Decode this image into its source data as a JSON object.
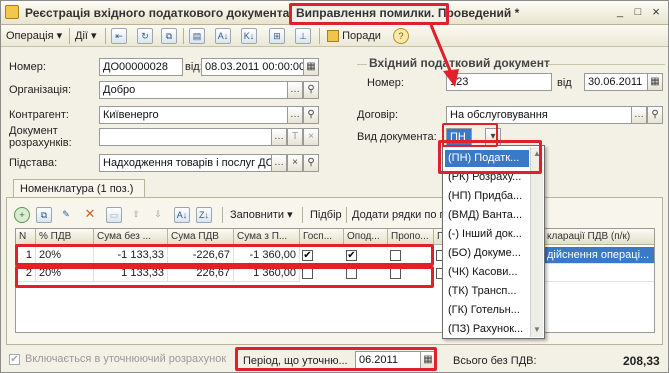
{
  "title": {
    "prefix": "Реєстрація вхідного податкового документа",
    "highlight": "Виправлення помилки. Проведений *"
  },
  "window_buttons": [
    "_",
    "□",
    "×"
  ],
  "toolbar": {
    "operation": "Операція",
    "actions": "Дії",
    "tips": "Поради",
    "icons": [
      "arrow-back-icon",
      "refresh-icon",
      "copy-icon",
      "post-icon",
      "sort-az-icon",
      "sort-ka-icon",
      "structure-icon",
      "pin-icon",
      "help-icon"
    ]
  },
  "form": {
    "number_label": "Номер:",
    "number_value": "ДО00000028",
    "from_label": "від:",
    "from_value": "08.03.2011 00:00:00",
    "org_label": "Організація:",
    "org_value": "Добро",
    "contractor_label": "Контрагент:",
    "contractor_value": "Київенерго",
    "settlement_doc_label_1": "Документ",
    "settlement_doc_label_2": "розрахунків:",
    "settlement_doc_value": "",
    "basis_label": "Підстава:",
    "basis_value": "Надходження товарів і послуг ДС"
  },
  "incoming_doc": {
    "group_title": "Вхідний податковий документ",
    "number_label": "Номер:",
    "number_value": "123",
    "from_label": "від",
    "from_value": "30.06.2011",
    "contract_label": "Договір:",
    "contract_value": "На обслуговування",
    "doc_type_label": "Вид документа:",
    "doc_type_value": "ПН"
  },
  "dropdown": {
    "items": [
      "(ПН) Податк...",
      "(РК) Розраху...",
      "(НП) Придба...",
      "(ВМД) Ванта...",
      "(-) Інший док...",
      "(БО) Докуме...",
      "(ЧК) Касови...",
      "(ТК) Трансп...",
      "(ГК) Готельн...",
      "(ПЗ) Рахунок..."
    ]
  },
  "tab": {
    "label": "Номенклатура (1 поз.)"
  },
  "grid_toolbar": {
    "fill": "Заповнити",
    "selection": "Підбір",
    "add_rows": "Додати рядки по п"
  },
  "grid": {
    "headers": [
      "N",
      "% ПДВ",
      "Сума без ...",
      "Сума ПДВ",
      "Сума з П...",
      "Госп...",
      "Опод...",
      "Пропо...",
      "П",
      "кларації ПДВ (п/к)"
    ],
    "rows": [
      {
        "n": "1",
        "vat": "20%",
        "without": "-1 133,33",
        "vat_sum": "-226,67",
        "with_vat": "-1 360,00",
        "c1": true,
        "c2": true,
        "c3": false,
        "c4": false,
        "decl": "дійснення операці..."
      },
      {
        "n": "2",
        "vat": "20%",
        "without": "1 133,33",
        "vat_sum": "226,67",
        "with_vat": "1 360,00",
        "c1": false,
        "c2": false,
        "c3": false,
        "c4": false,
        "decl": ""
      }
    ]
  },
  "bottom": {
    "include_label": "Включається в уточнюючий розрахунок",
    "period_label": "Період, що уточню...",
    "period_value": "06.2011",
    "total_label": "Всього без ПДВ:",
    "total_value": "208,33"
  },
  "colors": {
    "highlight_red": "#e0212b",
    "row_selected": "#3a78c8"
  }
}
